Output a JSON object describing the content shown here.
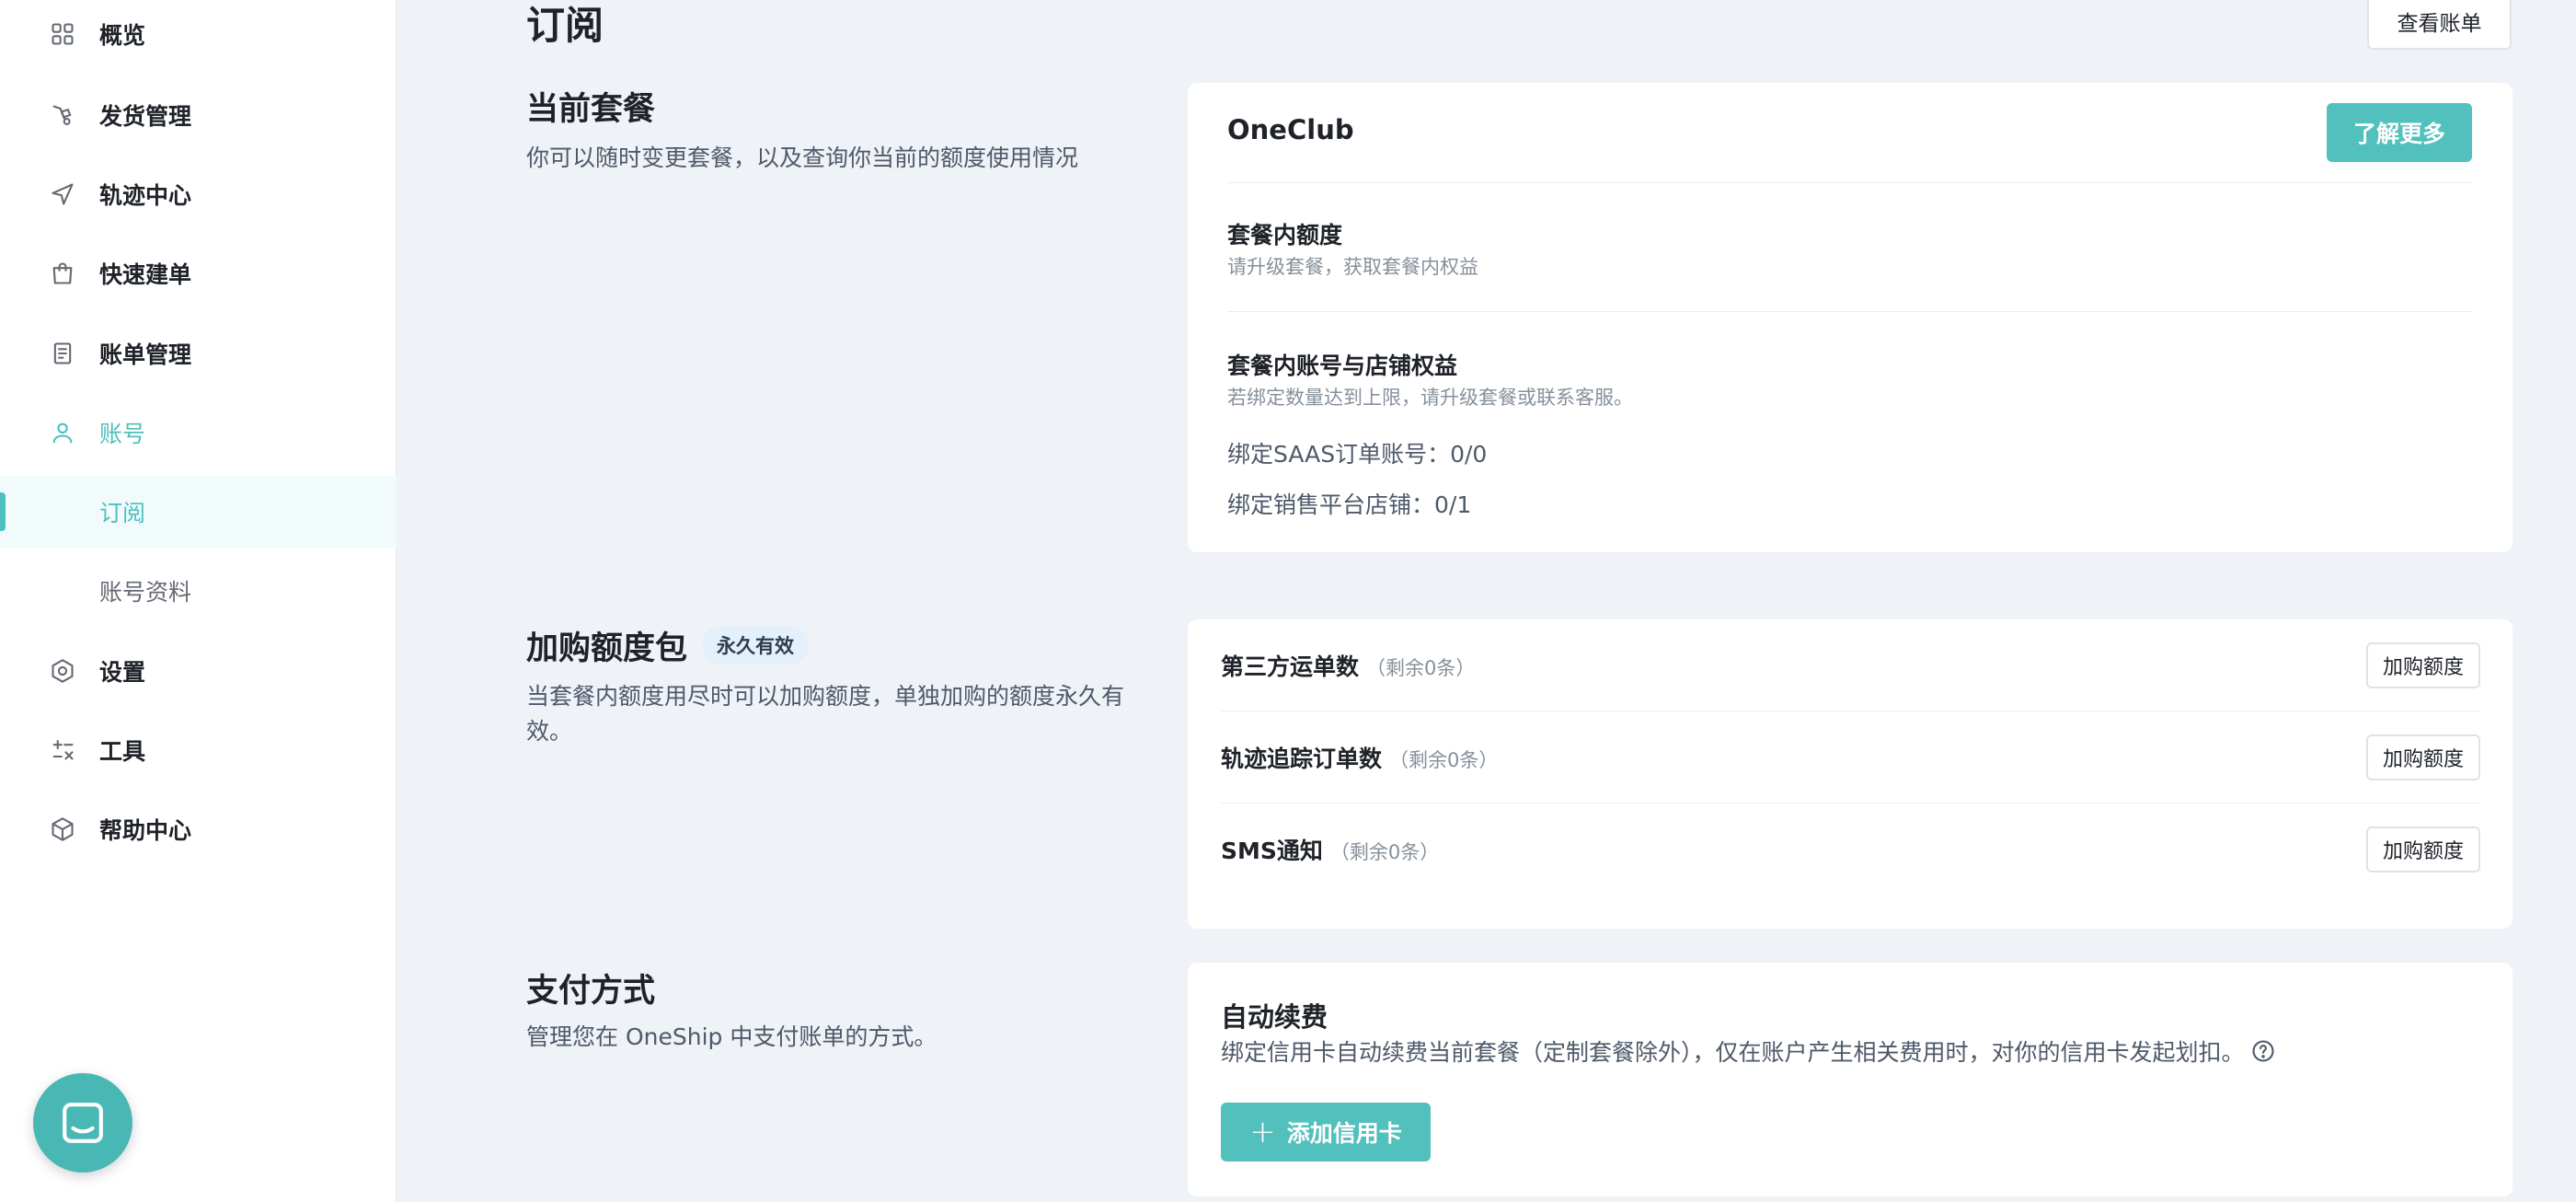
{
  "sidebar": {
    "items": [
      {
        "label": "概览",
        "icon": "grid-icon"
      },
      {
        "label": "发货管理",
        "icon": "shipping-icon"
      },
      {
        "label": "轨迹中心",
        "icon": "navigation-arrow-icon"
      },
      {
        "label": "快速建单",
        "icon": "shopping-bag-icon"
      },
      {
        "label": "账单管理",
        "icon": "bill-icon"
      },
      {
        "label": "账号",
        "icon": "user-icon"
      },
      {
        "label": "订阅"
      },
      {
        "label": "账号资料"
      },
      {
        "label": "设置",
        "icon": "settings-hexagon-icon"
      },
      {
        "label": "工具",
        "icon": "tools-icon"
      },
      {
        "label": "帮助中心",
        "icon": "cube-icon"
      }
    ],
    "selected": "订阅"
  },
  "header": {
    "title": "订阅",
    "view_bill_button": "查看账单"
  },
  "current_plan": {
    "title": "当前套餐",
    "description": "你可以随时变更套餐，以及查询你当前的额度使用情况",
    "plan_name": "OneClub",
    "learn_more_button": "了解更多",
    "quota_title": "套餐内额度",
    "quota_desc": "请升级套餐，获取套餐内权益",
    "rights_title": "套餐内账号与店铺权益",
    "rights_desc": "若绑定数量达到上限，请升级套餐或联系客服。",
    "saas_accounts": "绑定SAAS订单账号：0/0",
    "stores": "绑定销售平台店铺：0/1"
  },
  "addon_packages": {
    "title": "加购额度包",
    "tag": "永久有效",
    "description": "当套餐内额度用尽时可以加购额度，单独加购的额度永久有效。",
    "rows": [
      {
        "name": "第三方运单数",
        "remaining": "（剩余0条）",
        "button": "加购额度"
      },
      {
        "name": "轨迹追踪订单数",
        "remaining": "（剩余0条）",
        "button": "加购额度"
      },
      {
        "name": "SMS通知",
        "remaining": "（剩余0条）",
        "button": "加购额度"
      }
    ]
  },
  "payment": {
    "title": "支付方式",
    "description": "管理您在 OneShip 中支付账单的方式。",
    "autopay_title": "自动续费",
    "autopay_desc": "绑定信用卡自动续费当前套餐（定制套餐除外），仅在账户产生相关费用时，对你的信用卡发起划扣。",
    "add_card_button": "添加信用卡"
  },
  "colors": {
    "accent": "#4ebfbf",
    "button_primary": "#52c0bd",
    "page_background": "#eff2f7",
    "tag_background": "#e4f0fb"
  }
}
